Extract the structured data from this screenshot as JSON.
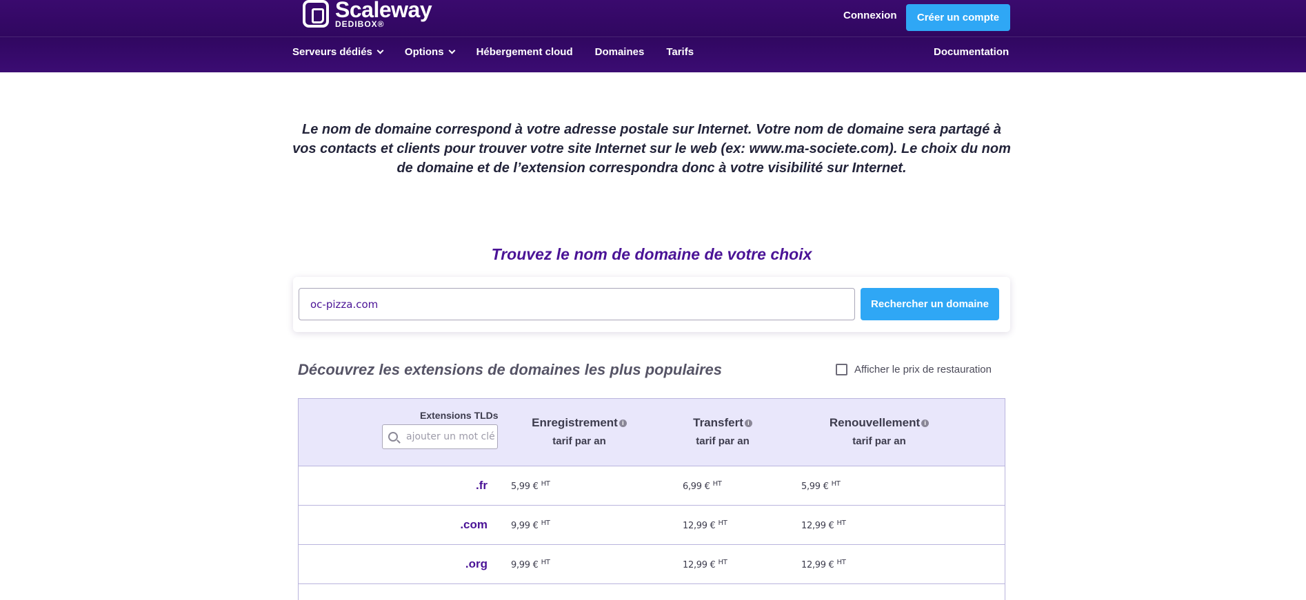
{
  "header": {
    "logo": {
      "name": "Scaleway",
      "sub": "DEDIBOX®"
    },
    "login_label": "Connexion",
    "signup_label": "Créer un compte",
    "nav": [
      {
        "label": "Serveurs dédiés",
        "has_menu": true
      },
      {
        "label": "Options",
        "has_menu": true
      },
      {
        "label": "Hébergement cloud",
        "has_menu": false
      },
      {
        "label": "Domaines",
        "has_menu": false
      },
      {
        "label": "Tarifs",
        "has_menu": false
      }
    ],
    "doc_label": "Documentation"
  },
  "intro": {
    "line1": "Le nom de domaine correspond à votre adresse postale sur Internet. Votre nom de domaine sera partagé à",
    "line2": "vos contacts et clients pour trouver votre site Internet sur le web (ex: www.ma-societe.com). Le choix du nom",
    "line3": "de domaine et de l’extension correspondra donc à votre visibilité sur Internet."
  },
  "search": {
    "title": "Trouvez le nom de domaine de votre choix",
    "value": "oc-pizza.com",
    "button_label": "Rechercher un domaine"
  },
  "popular": {
    "title": "Découvrez les extensions de domaines les plus populaires",
    "restore_label": "Afficher le prix de restauration",
    "restore_checked": false
  },
  "table": {
    "ext_header": "Extensions TLDs",
    "filter_placeholder": "ajouter un mot clé",
    "columns": [
      {
        "title": "Enregistrement",
        "sub": "tarif par an"
      },
      {
        "title": "Transfert",
        "sub": "tarif par an"
      },
      {
        "title": "Renouvellement",
        "sub": "tarif par an"
      }
    ],
    "info_glyph": "i",
    "tax_suffix": "HT",
    "rows": [
      {
        "ext": ".fr",
        "registration": "5,99 €",
        "transfer": "6,99 €",
        "renewal": "5,99 €"
      },
      {
        "ext": ".com",
        "registration": "9,99 €",
        "transfer": "12,99 €",
        "renewal": "12,99 €"
      },
      {
        "ext": ".org",
        "registration": "9,99 €",
        "transfer": "12,99 €",
        "renewal": "12,99 €"
      },
      {
        "ext": "",
        "registration": "",
        "transfer": "",
        "renewal": ""
      }
    ]
  },
  "colors": {
    "header_bg": "#300760",
    "accent_blue": "#2fa7f5",
    "brand_purple": "#4a1396",
    "table_head_bg": "#e9e7fb"
  }
}
